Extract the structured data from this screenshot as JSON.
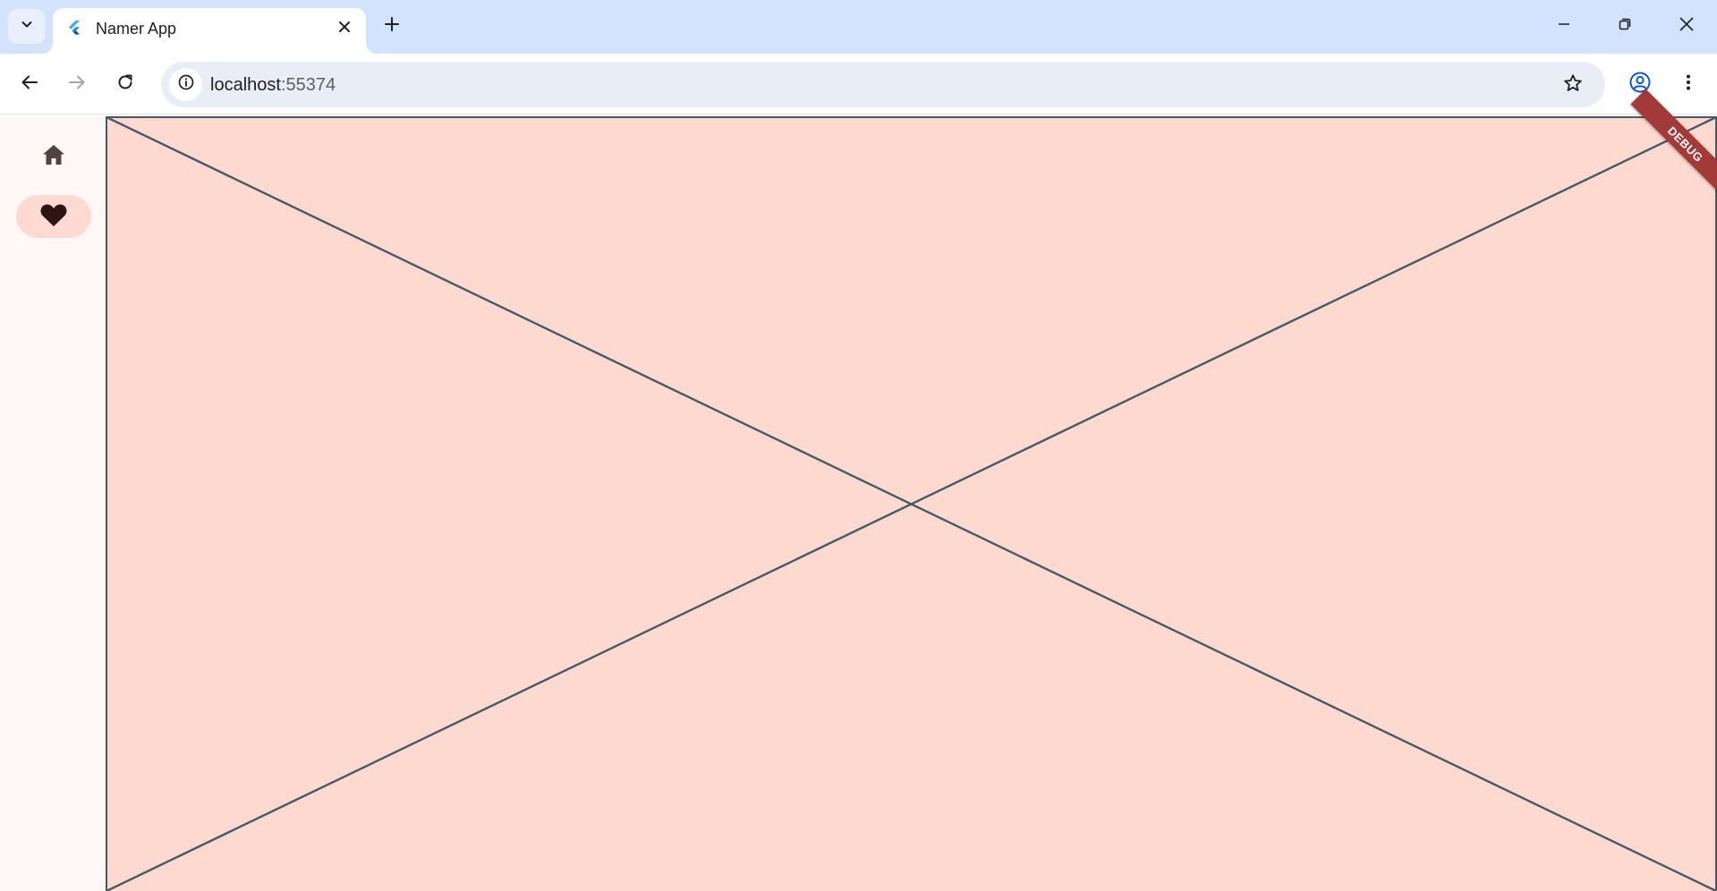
{
  "browser": {
    "tab": {
      "title": "Namer App"
    },
    "omnibox": {
      "url_host": "localhost",
      "url_port": ":55374"
    },
    "icons": {
      "tab_search": "chevron-down-icon",
      "favicon": "flutter-logo-icon",
      "close_tab": "close-icon",
      "new_tab": "plus-icon",
      "minimize": "minimize-icon",
      "restore": "restore-icon",
      "close_window": "close-icon",
      "back": "arrow-left-icon",
      "forward": "arrow-right-icon",
      "reload": "reload-icon",
      "site_info": "info-icon",
      "bookmark": "star-icon",
      "profile": "account-icon",
      "menu": "more-vert-icon"
    },
    "colors": {
      "tabstrip": "#d3e3fd",
      "omnibox": "#e9eef6"
    }
  },
  "app": {
    "navigation_rail": {
      "items": [
        {
          "name": "home",
          "icon": "home-icon",
          "selected": false
        },
        {
          "name": "favorites",
          "icon": "heart-icon",
          "selected": true
        }
      ]
    },
    "main": {
      "placeholder": "placeholder-x"
    },
    "debug_banner": "DEBUG",
    "colors": {
      "background": "#fff8f6",
      "placeholder_fill": "#fdd9d0",
      "placeholder_stroke": "#455a64",
      "rail_indicator": "#ffdad3",
      "banner": "#a33a3a"
    }
  }
}
